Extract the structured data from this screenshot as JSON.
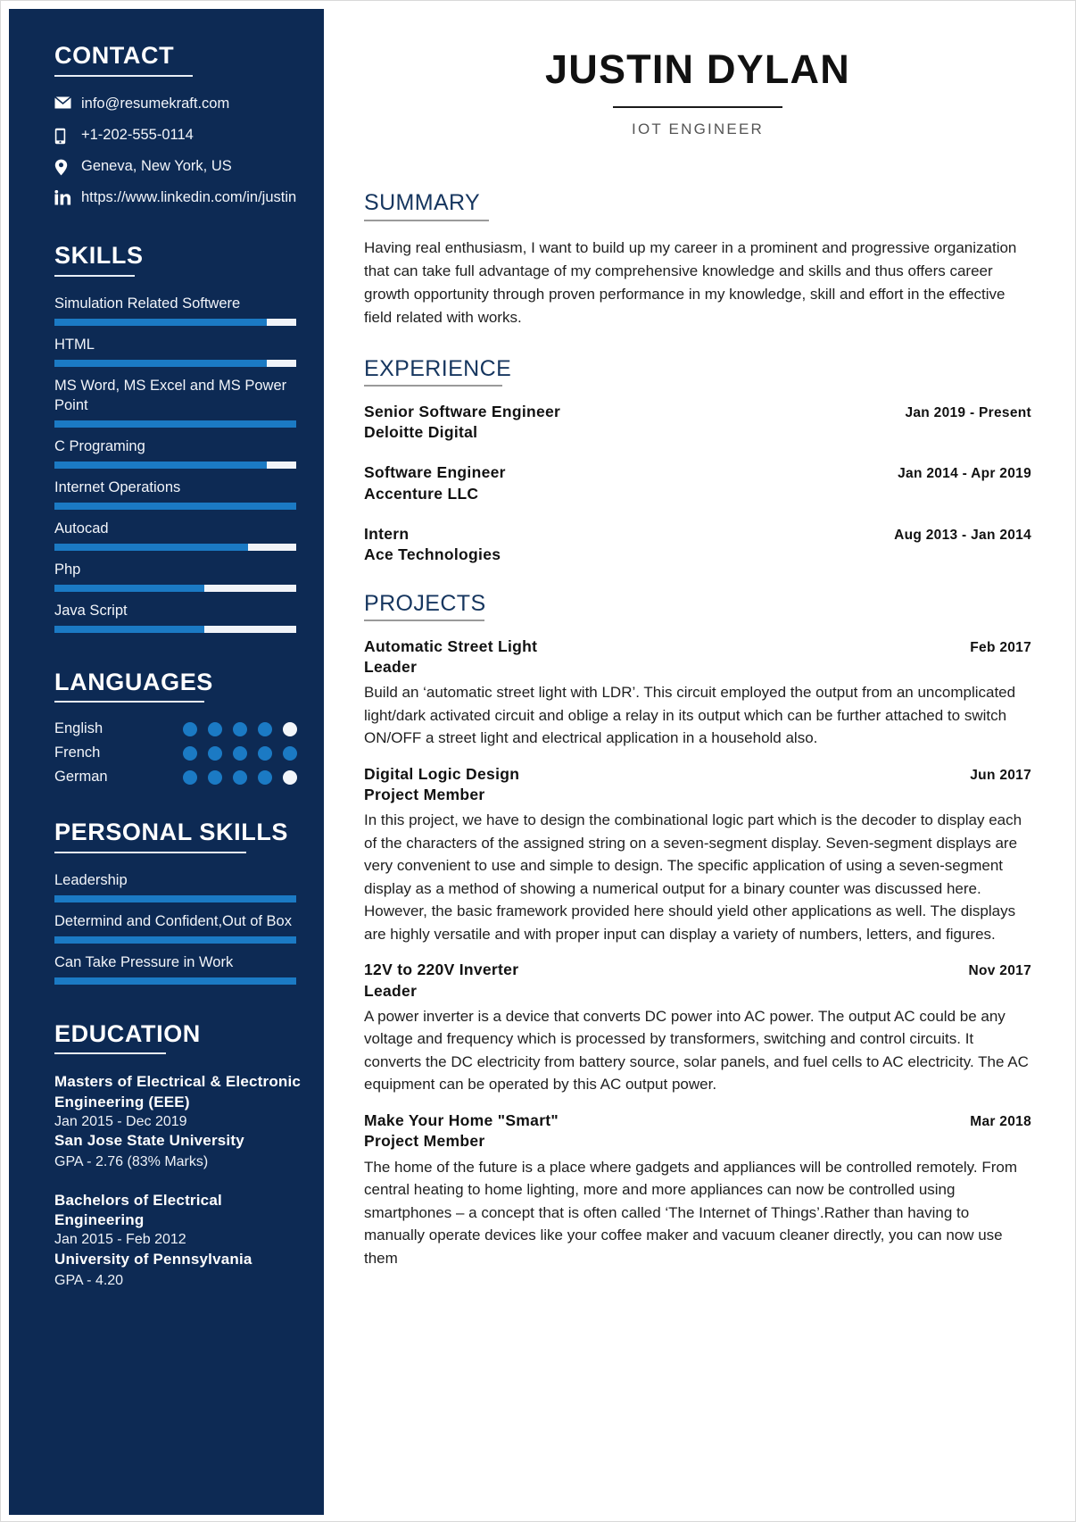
{
  "header": {
    "name": "JUSTIN DYLAN",
    "role": "IOT ENGINEER"
  },
  "sidebar": {
    "contact": {
      "heading": "CONTACT",
      "items": [
        {
          "icon": "envelope-icon",
          "value": "info@resumekraft.com"
        },
        {
          "icon": "phone-icon",
          "value": "+1-202-555-0114"
        },
        {
          "icon": "location-pin-icon",
          "value": "Geneva, New York, US"
        },
        {
          "icon": "linkedin-icon",
          "value": "https://www.linkedin.com/in/justin"
        }
      ]
    },
    "skills": {
      "heading": "SKILLS",
      "items": [
        {
          "label": "Simulation Related Softwere",
          "percent": 88
        },
        {
          "label": "HTML",
          "percent": 88
        },
        {
          "label": "MS Word, MS Excel and MS Power Point",
          "percent": 100
        },
        {
          "label": "C Programing",
          "percent": 88
        },
        {
          "label": "Internet Operations",
          "percent": 100
        },
        {
          "label": "Autocad",
          "percent": 80
        },
        {
          "label": "Php",
          "percent": 62
        },
        {
          "label": "Java Script",
          "percent": 62
        }
      ]
    },
    "languages": {
      "heading": "LANGUAGES",
      "max": 5,
      "items": [
        {
          "label": "English",
          "level": 4
        },
        {
          "label": "French",
          "level": 5
        },
        {
          "label": "German",
          "level": 4
        }
      ]
    },
    "personal_skills": {
      "heading": "PERSONAL SKILLS",
      "items": [
        {
          "label": "Leadership",
          "percent": 100
        },
        {
          "label": "Determind and Confident,Out of Box",
          "percent": 100
        },
        {
          "label": "Can Take Pressure in Work",
          "percent": 100
        }
      ]
    },
    "education": {
      "heading": "EDUCATION",
      "items": [
        {
          "degree": "Masters of Electrical & Electronic Engineering (EEE)",
          "dates": "Jan 2015 - Dec 2019",
          "school": "San Jose State University",
          "gpa": "GPA - 2.76 (83% Marks)"
        },
        {
          "degree": "Bachelors of Electrical Engineering",
          "dates": "Jan 2015 - Feb 2012",
          "school": "University of Pennsylvania",
          "gpa": "GPA - 4.20"
        }
      ]
    }
  },
  "main": {
    "summary": {
      "heading": "SUMMARY",
      "text": "Having real enthusiasm, I want to build up my career in a prominent and progressive organization that can take full advantage of my comprehensive knowledge and skills and thus offers career growth opportunity through proven performance in my knowledge, skill and effort in the effective field related with works."
    },
    "experience": {
      "heading": "EXPERIENCE",
      "items": [
        {
          "title": "Senior Software Engineer",
          "company": "Deloitte Digital",
          "date": "Jan 2019 - Present"
        },
        {
          "title": "Software Engineer",
          "company": "Accenture LLC",
          "date": "Jan 2014 - Apr 2019"
        },
        {
          "title": "Intern",
          "company": "Ace Technologies",
          "date": "Aug 2013 - Jan 2014"
        }
      ]
    },
    "projects": {
      "heading": "PROJECTS",
      "items": [
        {
          "title": "Automatic Street Light",
          "role": "Leader",
          "date": "Feb 2017",
          "description": "Build an ‘automatic street light with LDR’. This circuit employed the output from an uncomplicated light/dark activated circuit and oblige a relay in its output which can be further attached to switch ON/OFF a street light and electrical application in a household also."
        },
        {
          "title": "Digital Logic Design",
          "role": "Project Member",
          "date": "Jun 2017",
          "description": "In this project, we have to design the combinational logic part which is the decoder to display each of the characters of the assigned string on a seven-segment display. Seven-segment displays are very convenient to use and simple to design. The specific application of using a seven-segment display as a method of showing a numerical output for a binary counter was discussed here. However, the basic framework provided here should yield other applications as well. The displays are highly versatile and with proper input can display a variety of numbers, letters, and figures."
        },
        {
          "title": "12V to 220V Inverter",
          "role": "Leader",
          "date": "Nov 2017",
          "description": "A power inverter is a device that converts DC power into AC power. The output AC could be any voltage and frequency which is processed by transformers, switching and control circuits. It converts the DC electricity from battery source, solar panels, and fuel cells to AC electricity. The AC equipment can be operated by this AC output power."
        },
        {
          "title": "Make Your Home \"Smart\"",
          "role": "Project Member",
          "date": "Mar 2018",
          "description": "The home of the future is a place where gadgets and appliances will be controlled remotely. From central heating to home lighting, more and more appliances can now be controlled using smartphones – a concept that is often called ‘The Internet of Things’.Rather than having to manually operate devices like your coffee maker and vacuum cleaner directly, you can now use them"
        }
      ]
    }
  },
  "colors": {
    "sidebar_bg": "#0d2a54",
    "accent_bar": "#1b7ac4",
    "bar_track": "#f0f3f8",
    "heading_blue": "#16365f"
  }
}
